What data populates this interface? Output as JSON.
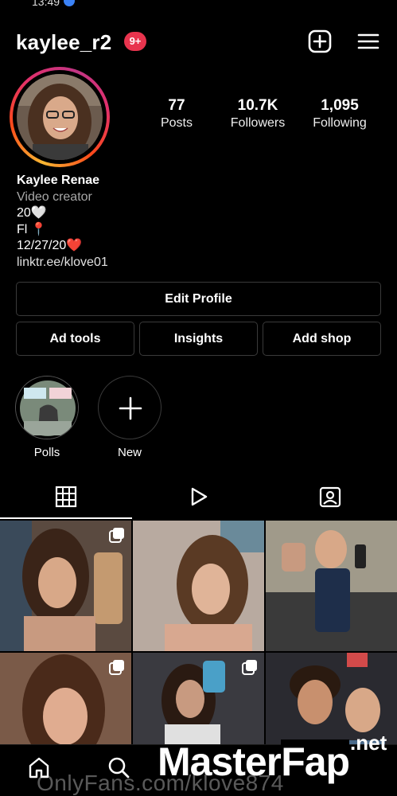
{
  "status_bar": {
    "time": "13:49"
  },
  "header": {
    "username": "kaylee_r2",
    "notification_badge": "9+",
    "create_icon": "plus-square-icon",
    "menu_icon": "hamburger-menu-icon"
  },
  "stats": {
    "posts": {
      "count": "77",
      "label": "Posts"
    },
    "followers": {
      "count": "10.7K",
      "label": "Followers"
    },
    "following": {
      "count": "1,095",
      "label": "Following"
    }
  },
  "bio": {
    "name": "Kaylee Renae",
    "category": "Video creator",
    "line1": "20🤍",
    "line2": "Fl 📍",
    "line3": "12/27/20❤️",
    "link": "linktr.ee/klove01"
  },
  "buttons": {
    "edit_profile": "Edit Profile",
    "ad_tools": "Ad tools",
    "insights": "Insights",
    "add_shop": "Add shop"
  },
  "highlights": [
    {
      "label": "Polls"
    },
    {
      "label": "New"
    }
  ],
  "tabs": [
    {
      "name": "grid",
      "icon": "grid-icon",
      "active": true
    },
    {
      "name": "reels",
      "icon": "play-icon",
      "active": false
    },
    {
      "name": "tagged",
      "icon": "tagged-person-icon",
      "active": false
    }
  ],
  "watermarks": {
    "onlyfans": "OnlyFans.com/klove874",
    "masterfap_a": "Master",
    "masterfap_b": "Fap",
    "net": ".net"
  },
  "colors": {
    "background": "#000000",
    "badge": "#e8344e",
    "border": "#3a3a3a",
    "muted_text": "#a8a8a8"
  }
}
